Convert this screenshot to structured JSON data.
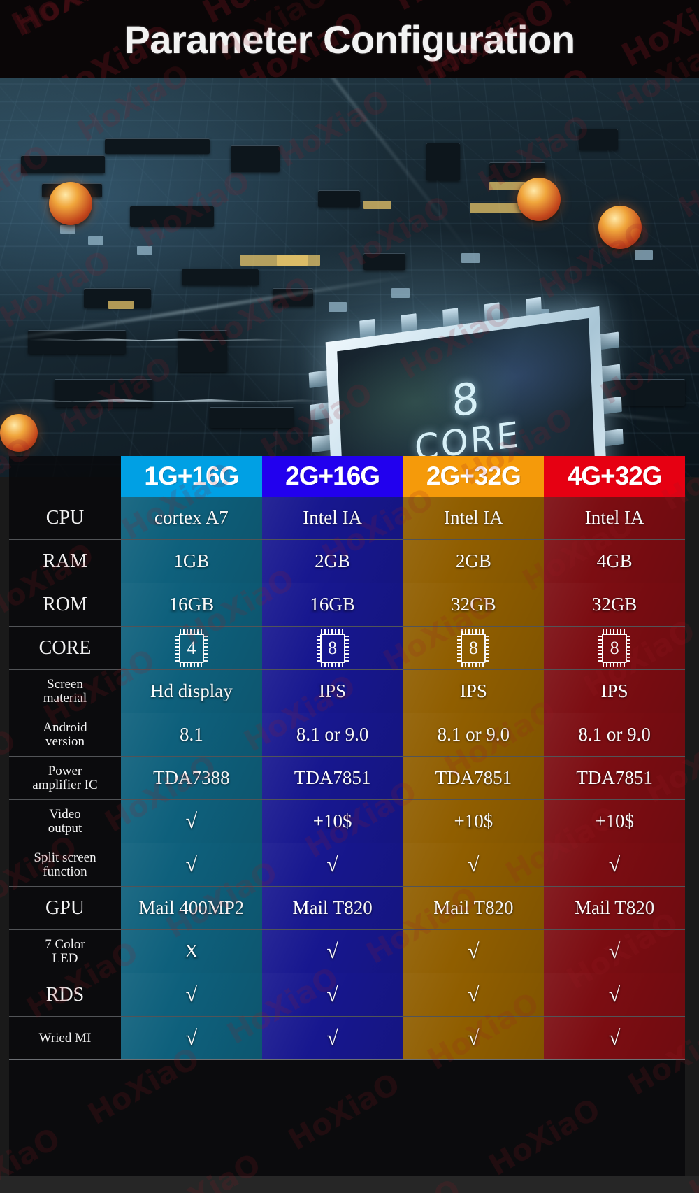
{
  "banner": {
    "title": "Parameter Configuration"
  },
  "hero": {
    "chip_number": "8",
    "chip_label": "CORE",
    "alt": "circuit-board-with-8-core-processor"
  },
  "watermark": {
    "text": "HoXiaO"
  },
  "table": {
    "columns": [
      {
        "id": "col1",
        "header": "1G+16G",
        "header_bg": "#00a0e4",
        "body_bg": "#106a8a"
      },
      {
        "id": "col2",
        "header": "2G+16G",
        "header_bg": "#2200ee",
        "body_bg": "#1a1a9e"
      },
      {
        "id": "col3",
        "header": "2G+32G",
        "header_bg": "#f59a0a",
        "body_bg": "#a06800"
      },
      {
        "id": "col4",
        "header": "4G+32G",
        "header_bg": "#e60012",
        "body_bg": "#8a0e14"
      }
    ],
    "rows": [
      {
        "label": "CPU",
        "label_size": "big",
        "type": "text",
        "values": [
          "cortex A7",
          "Intel IA",
          "Intel IA",
          "Intel IA"
        ]
      },
      {
        "label": "RAM",
        "label_size": "big",
        "type": "text",
        "values": [
          "1GB",
          "2GB",
          "2GB",
          "4GB"
        ]
      },
      {
        "label": "ROM",
        "label_size": "big",
        "type": "text",
        "values": [
          "16GB",
          "16GB",
          "32GB",
          "32GB"
        ]
      },
      {
        "label": "CORE",
        "label_size": "big",
        "type": "chip",
        "values": [
          "4",
          "8",
          "8",
          "8"
        ]
      },
      {
        "label": "Screen\nmaterial",
        "label_size": "sm",
        "type": "text",
        "values": [
          "Hd display",
          "IPS",
          "IPS",
          "IPS"
        ]
      },
      {
        "label": "Android\nversion",
        "label_size": "sm",
        "type": "text",
        "values": [
          "8.1",
          "8.1 or 9.0",
          "8.1 or 9.0",
          "8.1 or 9.0"
        ]
      },
      {
        "label": "Power\namplifier IC",
        "label_size": "sm",
        "type": "text",
        "values": [
          "TDA7388",
          "TDA7851",
          "TDA7851",
          "TDA7851"
        ]
      },
      {
        "label": "Video\noutput",
        "label_size": "sm",
        "type": "text",
        "values": [
          "√",
          "+10$",
          "+10$",
          "+10$"
        ]
      },
      {
        "label": "Split screen\nfunction",
        "label_size": "sm",
        "type": "text",
        "values": [
          "√",
          "√",
          "√",
          "√"
        ]
      },
      {
        "label": "GPU",
        "label_size": "big",
        "type": "text",
        "values": [
          "Mail 400MP2",
          "Mail T820",
          "Mail T820",
          "Mail T820"
        ]
      },
      {
        "label": "7 Color\nLED",
        "label_size": "sm",
        "type": "text",
        "values": [
          "X",
          "√",
          "√",
          "√"
        ]
      },
      {
        "label": "RDS",
        "label_size": "big",
        "type": "text",
        "values": [
          "√",
          "√",
          "√",
          "√"
        ]
      },
      {
        "label": "Wried MI",
        "label_size": "sm",
        "type": "text",
        "values": [
          "√",
          "√",
          "√",
          "√"
        ]
      }
    ]
  }
}
